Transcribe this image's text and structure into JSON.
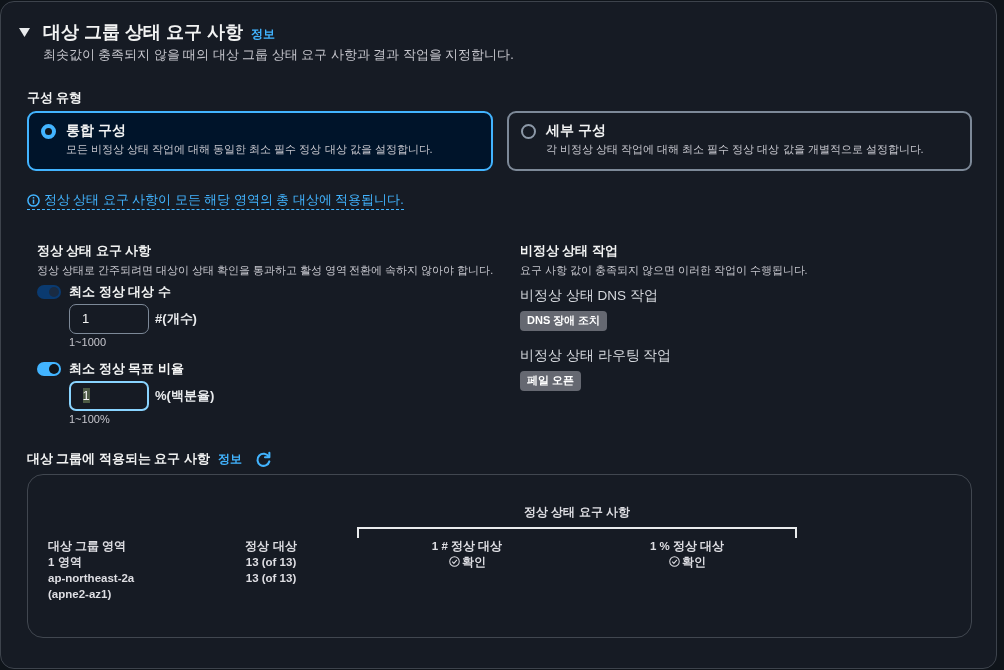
{
  "section": {
    "title": "대상 그룹 상태 요구 사항",
    "info_link": "정보",
    "expanded": true,
    "description": "최솟값이 충족되지 않을 때의 대상 그룹 상태 요구 사항과 결과 작업을 지정합니다."
  },
  "configuration_type": {
    "label": "구성 유형",
    "options": [
      {
        "title": "통합 구성",
        "description": "모든 비정상 상태 작업에 대해 동일한 최소 필수 정상 대상 값을 설정합니다.",
        "selected": true
      },
      {
        "title": "세부 구성",
        "description": "각 비정상 상태 작업에 대해 최소 필수 정상 대상 값을 개별적으로 설정합니다.",
        "selected": false
      }
    ]
  },
  "info_note": "정상 상태 요구 사항이 모든 해당 영역의 총 대상에 적용됩니다.",
  "healthy_requirements": {
    "title": "정상 상태 요구 사항",
    "description": "정상 상태로 간주되려면 대상이 상태 확인을 통과하고 활성 영역 전환에 속하지 않아야 합니다.",
    "settings": [
      {
        "label": "최소 정상 대상 수",
        "on": true,
        "disabled": true,
        "value": "1",
        "focused": false,
        "unit": "#(개수)",
        "hint": "1~1000"
      },
      {
        "label": "최소 정상 목표 비율",
        "on": true,
        "disabled": false,
        "value": "1",
        "focused": true,
        "unit": "%(백분율)",
        "hint": "1~100%"
      }
    ]
  },
  "unhealthy_actions": {
    "title": "비정상 상태 작업",
    "description": "요구 사항 값이 충족되지 않으면 이러한 작업이 수행됩니다.",
    "actions": [
      {
        "label": "비정상 상태 DNS 작업",
        "value": "DNS 장애 조치"
      },
      {
        "label": "비정상 상태 라우팅 작업",
        "value": "페일 오픈"
      }
    ]
  },
  "applied_requirements": {
    "title": "대상 그룹에 적용되는 요구 사항",
    "info_link": "정보",
    "table": {
      "columns": [
        {
          "kind": "text",
          "label": "대상 그룹 영역"
        },
        {
          "kind": "text",
          "label": "정상 대상"
        },
        {
          "kind": "group",
          "label": "정상 상태 요구 사항",
          "columns": [
            {
              "kind": "status",
              "label": "1 # 정상 대상"
            },
            {
              "kind": "status",
              "label": "1 % 정상 대상"
            }
          ]
        }
      ],
      "rows": [
        [
          "1 영역",
          "13 (of 13)",
          "확인",
          "확인"
        ],
        [
          "ap-northeast-2a (apne2-az1)",
          "13 (of 13)"
        ]
      ]
    }
  }
}
